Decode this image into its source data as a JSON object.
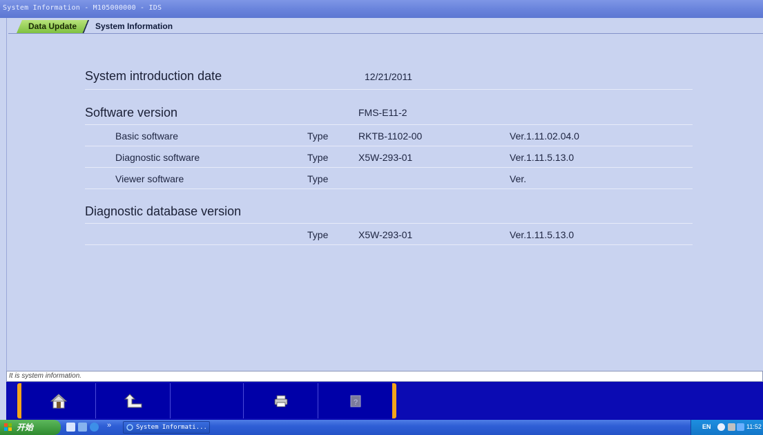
{
  "window": {
    "title": "System Information - M105000000 - IDS"
  },
  "tabs": [
    {
      "label": "Data Update",
      "active": true
    },
    {
      "label": "System Information",
      "active": false
    }
  ],
  "sections": {
    "intro": {
      "label": "System introduction date",
      "value": "12/21/2011"
    },
    "software": {
      "label": "Software version",
      "value": "FMS-E11-2",
      "rows": [
        {
          "name": "Basic software",
          "type_label": "Type",
          "type": "RKTB-1102-00",
          "ver": "Ver.1.11.02.04.0"
        },
        {
          "name": "Diagnostic software",
          "type_label": "Type",
          "type": "X5W-293-01",
          "ver": "Ver.1.11.5.13.0"
        },
        {
          "name": "Viewer software",
          "type_label": "Type",
          "type": "",
          "ver": "Ver."
        }
      ]
    },
    "database": {
      "label": "Diagnostic database version",
      "row": {
        "type_label": "Type",
        "type": "X5W-293-01",
        "ver": "Ver.1.11.5.13.0"
      }
    }
  },
  "status_message": "It is system information.",
  "toolbar": {
    "buttons": [
      {
        "icon": "home-icon",
        "enabled": true
      },
      {
        "icon": "back-arrow-icon",
        "enabled": true
      },
      {
        "icon": "empty",
        "enabled": false
      },
      {
        "icon": "printer-icon",
        "enabled": true
      },
      {
        "icon": "help-icon",
        "enabled": false
      }
    ]
  },
  "taskbar": {
    "start_label": "开始",
    "quick_more": "»",
    "task_label": "System Informati...",
    "lang": "EN",
    "clock": "11:52"
  },
  "colors": {
    "background": "#c9d3f0",
    "toolbar": "#0b0bb3",
    "accent_orange": "#f4a51a",
    "tab_active": "#8fcc4a"
  }
}
